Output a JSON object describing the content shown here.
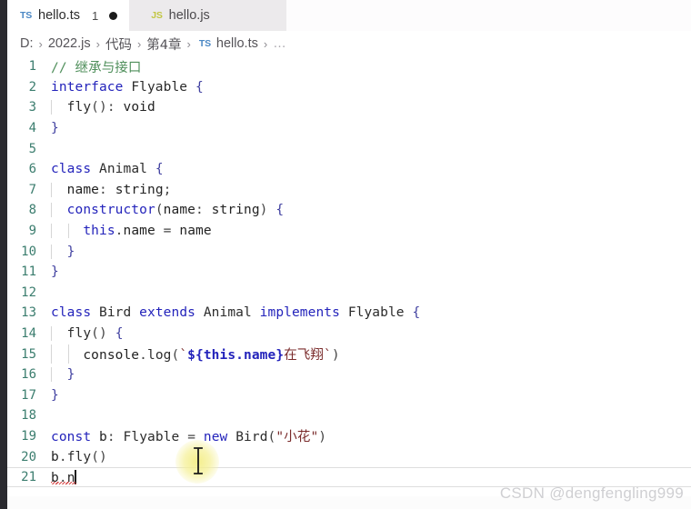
{
  "window": {
    "app": "Visual Studio Code",
    "theme": "light"
  },
  "tabs": [
    {
      "icon": "TS",
      "icon_name": "typescript-file-icon",
      "label": "hello.ts",
      "count": "1",
      "dirty": true,
      "active": true
    },
    {
      "icon": "JS",
      "icon_name": "javascript-file-icon",
      "label": "hello.js",
      "count": "",
      "dirty": false,
      "active": false
    }
  ],
  "breadcrumb": {
    "items": [
      "D:",
      "2022.js",
      "代码",
      "第4章",
      "hello.ts"
    ],
    "file_icon": "TS",
    "separator": "›",
    "trailing": "…"
  },
  "editor": {
    "language": "typescript",
    "current_line": 21,
    "caret_line": 21,
    "caret_text": "b.n",
    "lines": [
      {
        "n": "1",
        "text": "// 继承与接口"
      },
      {
        "n": "2",
        "text": "interface Flyable {"
      },
      {
        "n": "3",
        "text": "  fly(): void"
      },
      {
        "n": "4",
        "text": "}"
      },
      {
        "n": "5",
        "text": ""
      },
      {
        "n": "6",
        "text": "class Animal {"
      },
      {
        "n": "7",
        "text": "  name: string;"
      },
      {
        "n": "8",
        "text": "  constructor(name: string) {"
      },
      {
        "n": "9",
        "text": "    this.name = name"
      },
      {
        "n": "10",
        "text": "  }"
      },
      {
        "n": "11",
        "text": "}"
      },
      {
        "n": "12",
        "text": ""
      },
      {
        "n": "13",
        "text": "class Bird extends Animal implements Flyable {"
      },
      {
        "n": "14",
        "text": "  fly() {"
      },
      {
        "n": "15",
        "text": "    console.log(`${this.name}在飞翔`)"
      },
      {
        "n": "16",
        "text": "  }"
      },
      {
        "n": "17",
        "text": "}"
      },
      {
        "n": "18",
        "text": ""
      },
      {
        "n": "19",
        "text": "const b: Flyable = new Bird(\"小花\")"
      },
      {
        "n": "20",
        "text": "b.fly()"
      },
      {
        "n": "21",
        "text": "b.n"
      }
    ]
  },
  "overlay": {
    "watermark": "CSDN @dengfengling999",
    "cursor": "i-beam-text-cursor"
  },
  "colors": {
    "keyword": "#2323bb",
    "comment": "#4f8f5b",
    "string": "#7a2b2b",
    "line_number": "#3b7d6e",
    "background": "#ffffff",
    "tab_inactive": "#eceaec",
    "activity_bar": "#2b2b30",
    "error_squiggle": "#d64545",
    "click_glow": "#f3ed82"
  }
}
